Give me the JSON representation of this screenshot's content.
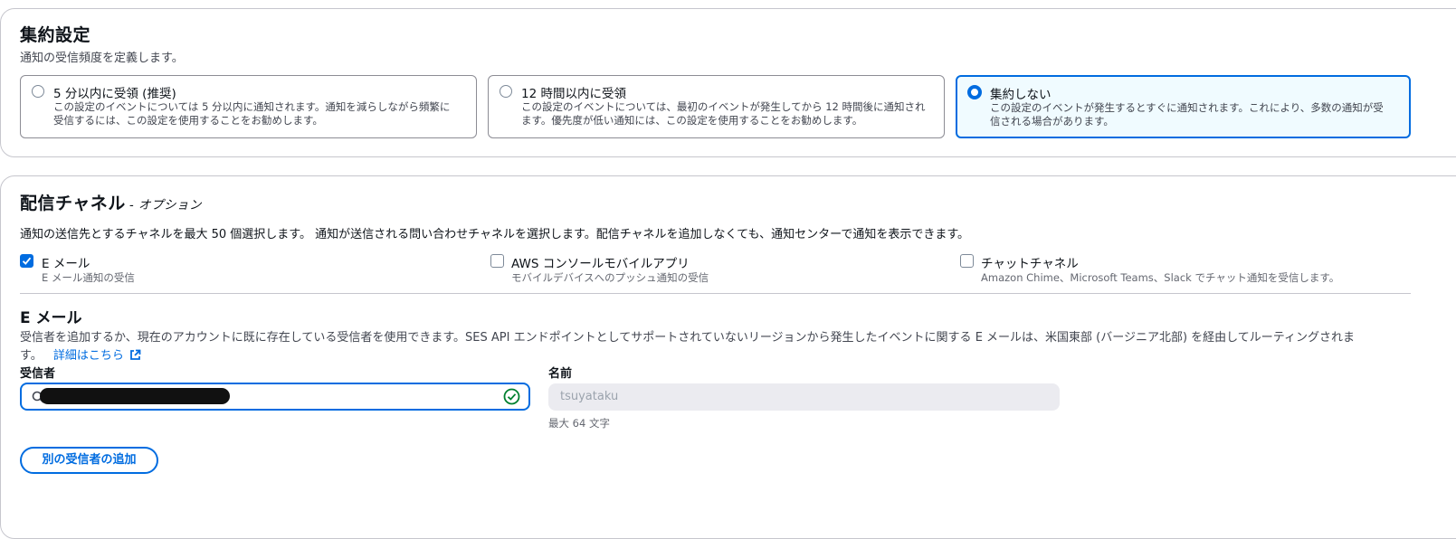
{
  "aggregation": {
    "title": "集約設定",
    "description": "通知の受信頻度を定義します。",
    "options": [
      {
        "label": "5 分以内に受領 (推奨)",
        "line1": "この設定のイベントについては 5 分以内に通知されます。通知を減らしながら頻繁に",
        "line2": "受信するには、この設定を使用することをお勧めします。",
        "selected": false
      },
      {
        "label": "12 時間以内に受領",
        "line1": "この設定のイベントについては、最初のイベントが発生してから 12 時間後に通知され",
        "line2": "ます。優先度が低い通知には、この設定を使用することをお勧めします。",
        "selected": false
      },
      {
        "label": "集約しない",
        "line1": "この設定のイベントが発生するとすぐに通知されます。これにより、多数の通知が受",
        "line2": "信される場合があります。",
        "selected": true
      }
    ]
  },
  "channels": {
    "title": "配信チャネル",
    "optional": "- オプション",
    "description": "通知の送信先とするチャネルを最大 50 個選択します。 通知が送信される問い合わせチャネルを選択します。配信チャネルを追加しなくても、通知センターで通知を表示できます。",
    "items": [
      {
        "label": "E メール",
        "sub": "E メール通知の受信",
        "checked": true
      },
      {
        "label": "AWS コンソールモバイルアプリ",
        "sub": "モバイルデバイスへのプッシュ通知の受信",
        "checked": false
      },
      {
        "label": "チャットチャネル",
        "sub": "Amazon Chime、Microsoft Teams、Slack でチャット通知を受信します。",
        "checked": false
      }
    ]
  },
  "email": {
    "title": "E メール",
    "description_line1": "受信者を追加するか、現在のアカウントに既に存在している受信者を使用できます。SES API エンドポイントとしてサポートされていないリージョンから発生したイベントに関する E メールは、米国東部 (バージニア北部) を経由してルーティングされま",
    "description_line2": "す。",
    "learn_more": "詳細はこちら",
    "recipient_label": "受信者",
    "name_label": "名前",
    "name_value": "tsuyataku",
    "name_hint": "最大 64 文字",
    "add_button": "別の受信者の追加"
  },
  "colors": {
    "accent": "#006ce0",
    "success": "#00802f"
  }
}
